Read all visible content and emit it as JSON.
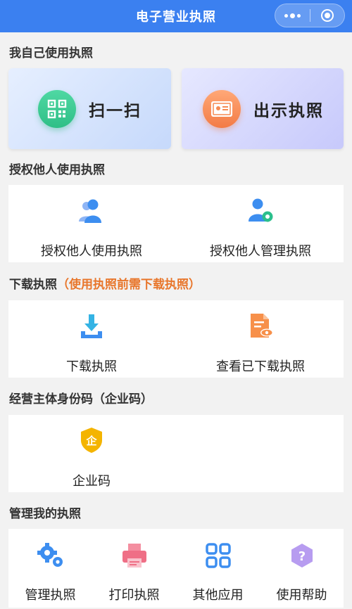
{
  "nav": {
    "title": "电子营业执照",
    "more_icon": "more-dots-icon",
    "close_icon": "target-circle-icon"
  },
  "sections": {
    "self": {
      "title": "我自己使用执照",
      "scan": {
        "label": "扫一扫",
        "icon": "qr-scan-icon",
        "color": "#35c98f"
      },
      "show": {
        "label": "出示执照",
        "icon": "license-card-icon",
        "color": "#f58a52"
      }
    },
    "authorize": {
      "title": "授权他人使用执照",
      "items": [
        {
          "label": "授权他人使用执照",
          "icon": "users-icon"
        },
        {
          "label": "授权他人管理执照",
          "icon": "user-gear-icon"
        }
      ]
    },
    "download": {
      "title": "下载执照",
      "note": "（使用执照前需下载执照）",
      "items": [
        {
          "label": "下载执照",
          "icon": "download-tray-icon"
        },
        {
          "label": "查看已下载执照",
          "icon": "document-eye-icon"
        }
      ]
    },
    "entity": {
      "title": "经营主体身份码（企业码）",
      "items": [
        {
          "label": "企业码",
          "icon": "shield-qi-icon",
          "glyph": "企"
        }
      ]
    },
    "manage": {
      "title": "管理我的执照",
      "items": [
        {
          "label": "管理执照",
          "icon": "gears-icon"
        },
        {
          "label": "打印执照",
          "icon": "printer-icon"
        },
        {
          "label": "其他应用",
          "icon": "apps-grid-icon"
        },
        {
          "label": "使用帮助",
          "icon": "help-question-icon",
          "glyph": "?"
        }
      ]
    }
  },
  "colors": {
    "nav_bg": "#3b80f0",
    "accent_blue": "#3d8ef0",
    "accent_orange": "#e8762b",
    "page_bg": "#f2f2f2"
  }
}
